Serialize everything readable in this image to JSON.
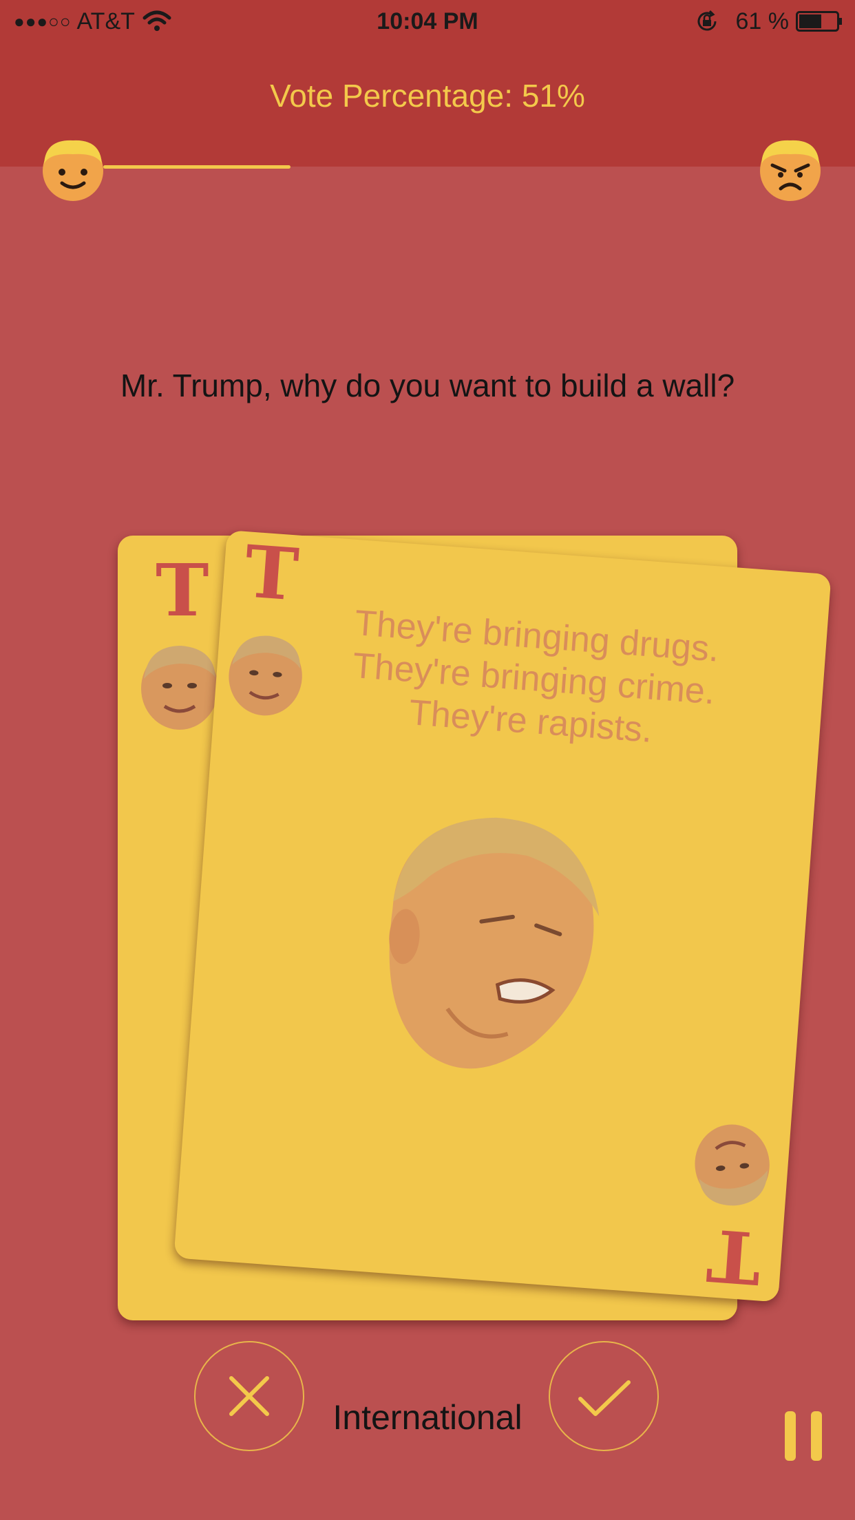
{
  "status_bar": {
    "carrier": "AT&T",
    "signal": "●●●○○",
    "time": "10:04 PM",
    "battery_percent": "61 %",
    "battery_level": 0.61,
    "icons": [
      "wifi-icon",
      "rotation-lock-icon",
      "battery-icon"
    ]
  },
  "header": {
    "vote_label": "Vote Percentage: 51%",
    "vote_value": 51,
    "accent_color": "#f3c94b",
    "background_color": "#b23a37"
  },
  "meter": {
    "left_icon": "happy-face-icon",
    "right_icon": "angry-face-icon"
  },
  "question": "Mr. Trump, why do you want to build a wall?",
  "cards": {
    "corner_letter": "T",
    "front_quote": "They're bringing drugs. They're bringing crime. They're rapists.",
    "card_color": "#f2c74c",
    "letter_color": "#c9504a"
  },
  "footer": {
    "category": "International",
    "reject_icon": "close-icon",
    "accept_icon": "checkmark-icon",
    "pause_icon": "pause-icon"
  },
  "colors": {
    "page_background": "#bb5050",
    "accent": "#f3c94b"
  }
}
